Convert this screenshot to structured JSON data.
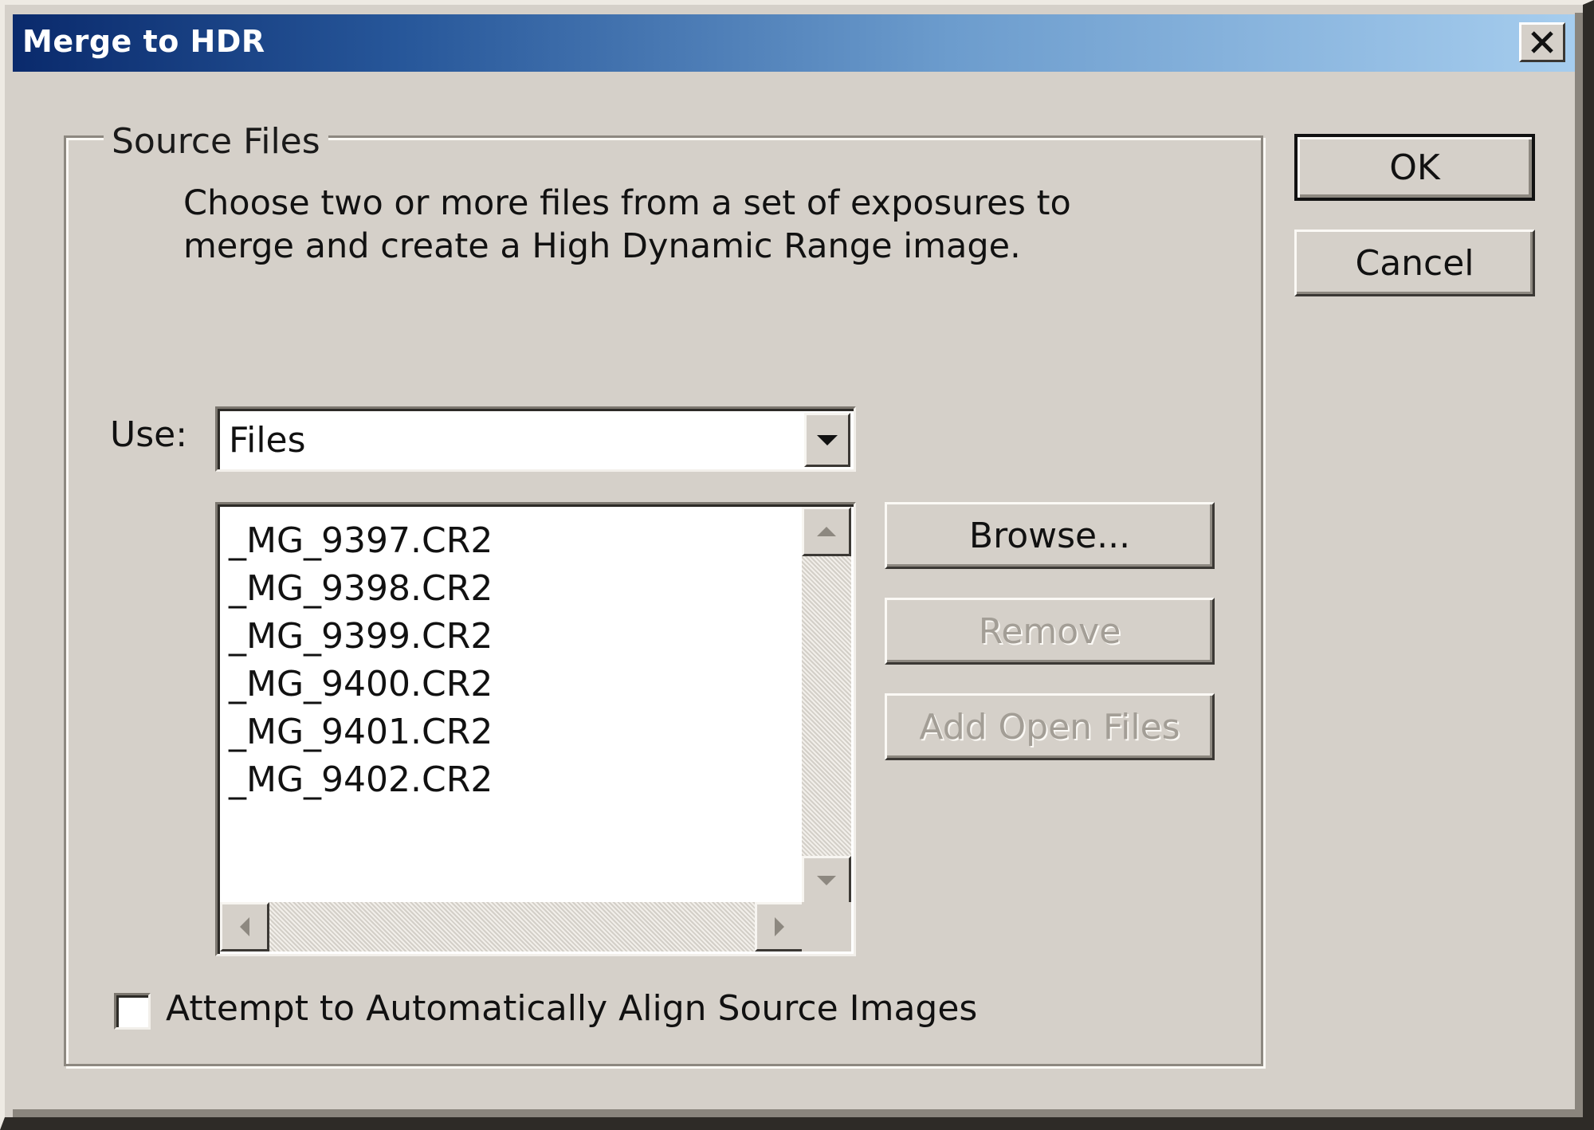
{
  "window": {
    "title": "Merge to HDR",
    "close_icon": "close-icon"
  },
  "source_files": {
    "legend": "Source Files",
    "description_line1": "Choose two or more files from a set of exposures to",
    "description_line2": "merge and create a High Dynamic Range image.",
    "use_label": "Use:",
    "use_selected": "Files",
    "files": [
      "_MG_9397.CR2",
      "_MG_9398.CR2",
      "_MG_9399.CR2",
      "_MG_9400.CR2",
      "_MG_9401.CR2",
      "_MG_9402.CR2"
    ],
    "browse_label": "Browse...",
    "remove_label": "Remove",
    "add_open_files_label": "Add Open Files",
    "align_checkbox_label": "Attempt to Automatically Align Source Images",
    "align_checked": false
  },
  "buttons": {
    "ok_label": "OK",
    "cancel_label": "Cancel"
  }
}
